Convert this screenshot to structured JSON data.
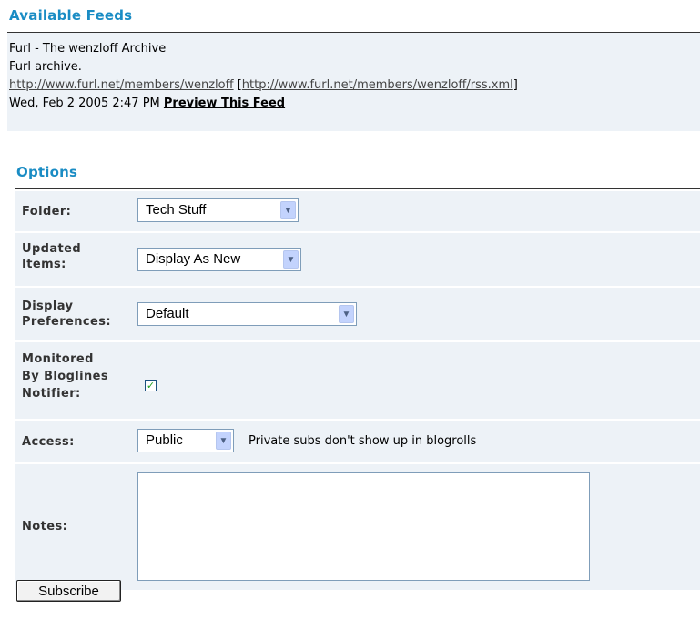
{
  "feeds": {
    "title": "Available Feeds",
    "feed_title": "Furl - The wenzloff Archive",
    "description": "Furl archive.",
    "site_url": "http://www.furl.net/members/wenzloff",
    "bracket_open": "[",
    "rss_url": "http://www.furl.net/members/wenzloff/rss.xml",
    "bracket_close": "]",
    "date": "Wed, Feb 2 2005 2:47 PM",
    "preview_label": "Preview This Feed"
  },
  "options": {
    "title": "Options",
    "folder": {
      "label": "Folder:",
      "value": "Tech Stuff"
    },
    "updated_items": {
      "label_line1": "Updated",
      "label_line2": "Items:",
      "value": "Display As New"
    },
    "display_preferences": {
      "label_line1": "Display",
      "label_line2": "Preferences:",
      "value": "Default"
    },
    "monitored": {
      "label_line1": "Monitored",
      "label_line2": "By Bloglines",
      "label_line3": "Notifier:",
      "checked": true
    },
    "access": {
      "label": "Access:",
      "value": "Public",
      "hint": "Private subs don't show up in blogrolls"
    },
    "notes": {
      "label": "Notes:",
      "value": ""
    }
  },
  "subscribe_label": "Subscribe",
  "colors": {
    "accent": "#1a8cc4",
    "row_bg": "#edf2f7",
    "check": "#21a121"
  }
}
